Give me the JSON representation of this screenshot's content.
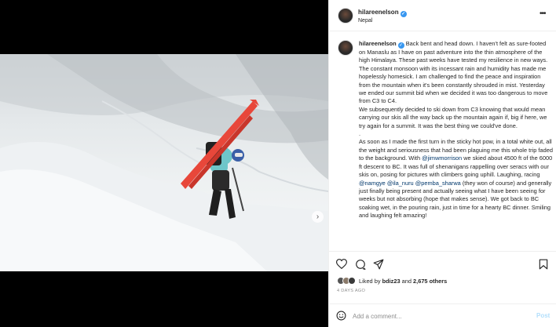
{
  "post": {
    "username": "hilareenelson",
    "location": "Nepal",
    "more_icon": "more-horizontal-icon"
  },
  "caption": {
    "username": "hilareenelson",
    "p1": "Back bent and head down. I haven't felt as sure-footed on Manaslu as I have on past adventure into the thin atmosphere of the high Himalaya. These past weeks have tested my resilience in new ways. The constant monsoon with its incessant rain and humidity has made me hopelessly homesick. I am challenged to find the peace and inspiration from the mountain when it's been constantly shrouded in mist. Yesterday we ended our summit bid when we decided it was too dangerous to move from C3 to C4.",
    "p2": "We subsequently decided to ski down from C3 knowing that would mean carrying our skis all the way back up the mountain again if, big if here, we try again for a summit. It was the best thing we could've done.",
    "sep": ".",
    "p3a": "As soon as I made the first turn in the sticky hot pow, in a total white out, all the weight and seriousness that had been plaguing me this whole trip faded to the background. With ",
    "m1": "@jimwmorrison",
    "p3b": " we skied about 4500 ft of the 6000 ft descent to BC. It was full of shenanigans rappelling over seracs with our skis on, posing for pictures with climbers going uphill. Laughing, racing ",
    "m2": "@namgye",
    "m3": "@ila_nuru",
    "m4": "@pemba_sharwa",
    "p3c": " (they won of course) and generally just finally being present and actually seeing what I have been seeing for weeks but not absorbing (hope that makes sense). We got back to BC soaking wet, in the pouring rain, just in time for a hearty BC dinner. Smiling and laughing felt amazing!"
  },
  "actions": {
    "like_icon": "heart-icon",
    "comment_icon": "comment-icon",
    "share_icon": "share-icon",
    "save_icon": "bookmark-icon"
  },
  "likes": {
    "prefix": "Liked by ",
    "user": "bdiz23",
    "middle": " and ",
    "count": "2,675 others"
  },
  "date": "4 DAYS AGO",
  "comment": {
    "placeholder": "Add a comment...",
    "post_label": "Post",
    "emoji_icon": "smiley-icon"
  },
  "media": {
    "next_icon": "chevron-right-icon",
    "tag_icon": "user-tag-icon",
    "carousel_total": 4,
    "carousel_active": 1
  },
  "colors": {
    "link": "#00376b",
    "verified": "#3897f0",
    "post_disabled": "#b2dffc",
    "jacket": "#6ec6c9",
    "skis": "#e8473a"
  }
}
